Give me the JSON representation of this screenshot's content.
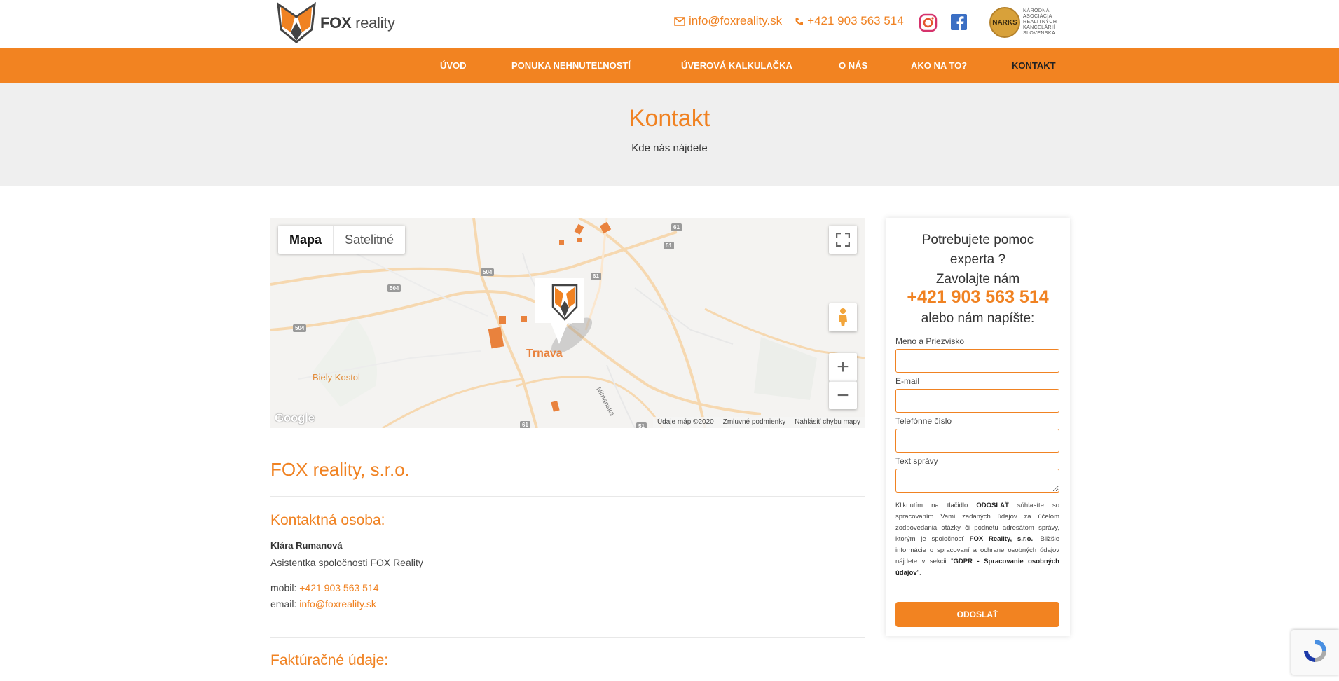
{
  "header": {
    "logo_bold": "FOX",
    "logo_rest": " reality",
    "email": "info@foxreality.sk",
    "phone": "+421 903 563 514",
    "social": [
      "instagram-icon",
      "facebook-icon"
    ],
    "narks_badge": "NARKS",
    "narks_lines": [
      "NÁRODNÁ",
      "ASOCIÁCIA",
      "REALITNÝCH",
      "KANCELÁRIÍ",
      "SLOVENSKA"
    ]
  },
  "nav": {
    "items": [
      {
        "label": "ÚVOD"
      },
      {
        "label": "PONUKA NEHNUTEĽNOSTÍ"
      },
      {
        "label": "ÚVEROVÁ KALKULAČKA"
      },
      {
        "label": "O NÁS"
      },
      {
        "label": "AKO NA TO?"
      },
      {
        "label": "KONTAKT"
      }
    ],
    "active": "KONTAKT"
  },
  "hero": {
    "title": "Kontakt",
    "subtitle": "Kde nás nájdete"
  },
  "map": {
    "toggle_map": "Mapa",
    "toggle_satellite": "Satelitné",
    "city": "Trnava",
    "place": "Biely Kostol",
    "street": "Nitrianska",
    "roads": [
      "61",
      "51",
      "504",
      "504",
      "504",
      "61",
      "61",
      "51"
    ],
    "zoom_in": "+",
    "zoom_out": "−",
    "brand": "Google",
    "footer": [
      "Údaje máp ©2020",
      "Zmluvné podmienky",
      "Nahlásiť chybu mapy"
    ]
  },
  "company": {
    "name": "FOX reality, s.r.o.",
    "contact_title": "Kontaktná osoba:",
    "person": "Klára Rumanová",
    "role": "Asistentka spoločnosti FOX Reality",
    "mobile_label": "mobil: ",
    "mobile": "+421 903 563 514",
    "email_label": "email: ",
    "email": "info@foxreality.sk",
    "billing_title": "Faktúračné údaje:"
  },
  "form": {
    "q1": "Potrebujete pomoc",
    "q2": "experta ?",
    "q3": "Zavolajte nám",
    "phone": "+421 903 563 514",
    "q4": "alebo nám napíšte:",
    "fields": [
      {
        "label": "Meno a Priezvisko"
      },
      {
        "label": "E-mail"
      },
      {
        "label": "Telefónne číslo"
      },
      {
        "label": "Text správy"
      }
    ],
    "gdpr_1": "Kliknutím na tlačidlo ",
    "gdpr_btn": "ODOSLAŤ",
    "gdpr_2": " súhlasíte so spracovaním Vami zadaných údajov za účelom zodpovedania otázky či podnetu adresátom správy, ktorým je spoločnosť ",
    "gdpr_company": "FOX Reality, s.r.o.",
    "gdpr_3": ". Bližšie informácie o spracovaní a ochrane osobných údajov nájdete v sekcii \"",
    "gdpr_section": "GDPR - Spracovanie osobných údajov",
    "gdpr_4": "\".",
    "submit": "ODOSLAŤ"
  },
  "colors": {
    "accent": "#f28321",
    "hero_bg": "#efefef"
  }
}
